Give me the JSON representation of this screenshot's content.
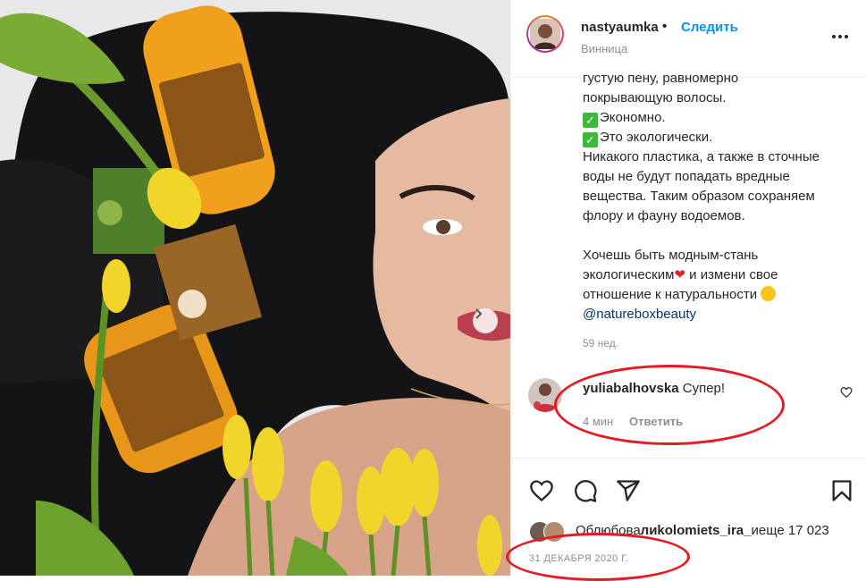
{
  "header": {
    "username": "nastyaumka",
    "separator": "•",
    "follow_label": "Следить",
    "location": "Винница",
    "more_icon": "more-horizontal-icon"
  },
  "caption": {
    "lines": [
      "густую пену, равномерно",
      "покрывающую волосы.",
      "Экономно.",
      "Это экологически.",
      "Никакого пластика, а также в сточные",
      "воды не будут попадать вредные",
      "вещества. Таким образом сохраняем",
      "флору и фауну водоемов.",
      "",
      "Хочешь быть модным-стань",
      "экологическим",
      "и измени свое",
      "отношение к натуральности",
      "@natureboxbeauty"
    ],
    "check_mark": "✓",
    "heart": "❤",
    "age": "59 нед."
  },
  "comment": {
    "username": "yuliabalhovska",
    "text": "Супер!",
    "time": "4 мин",
    "reply_label": "Ответить"
  },
  "actions": {
    "icons": [
      "heart-icon",
      "comment-icon",
      "share-icon",
      "bookmark-icon"
    ]
  },
  "likes": {
    "prefix": "Oбл",
    "middle": "юбова",
    "liker": "лиkolomiets_ira_",
    "suffix": "иеще 17 023"
  },
  "date": "31 ДЕКАБРЯ 2020 Г.",
  "colors": {
    "accent_blue": "#0095f6",
    "annotation_red": "#e41b23",
    "muted": "#8e8e8e"
  }
}
